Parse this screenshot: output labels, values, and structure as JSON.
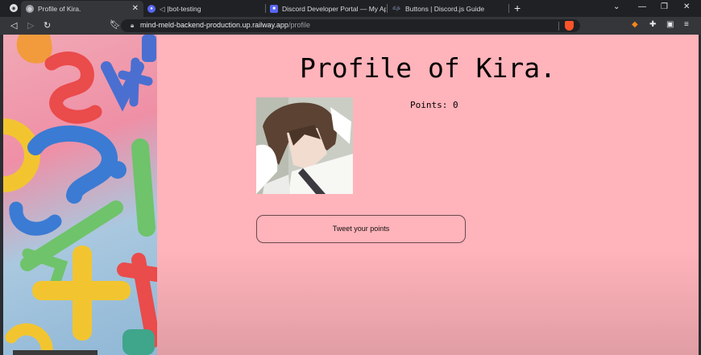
{
  "browser": {
    "tabs": [
      {
        "title": "Profile of Kira.",
        "active": true
      },
      {
        "title": "|bot-testing"
      },
      {
        "title": "Discord Developer Portal — My Appli"
      },
      {
        "title": "Buttons | Discord.js Guide"
      }
    ],
    "new_tab": "+",
    "url": {
      "host": "mind-meld-backend-production.up.railway.app",
      "path": "/profile"
    }
  },
  "page": {
    "title": "Profile of Kira.",
    "points_label": "Points: 0",
    "tweet_button": "Tweet your points",
    "background_color": "#ffb3ba"
  },
  "icons": {
    "back": "back-icon",
    "forward": "forward-icon",
    "reload": "reload-icon",
    "bookmark": "bookmark-icon",
    "lock": "lock-icon",
    "brave_shield": "brave-shield-icon",
    "extensions": "puzzle-icon",
    "wallet": "wallet-icon",
    "menu": "menu-icon"
  }
}
